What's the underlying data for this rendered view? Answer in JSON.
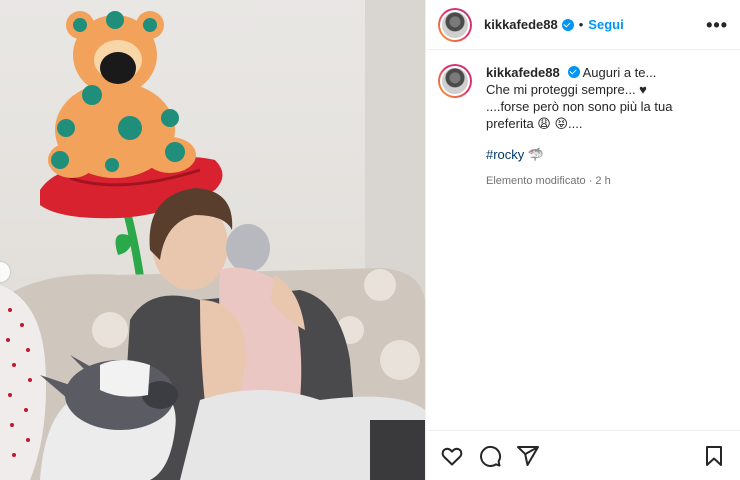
{
  "header": {
    "username": "kikkafede88",
    "follow_label": "Segui",
    "more_label": "•••"
  },
  "caption": {
    "username": "kikkafede88",
    "lines": [
      "Auguri a te...",
      "Che mi proteggi sempre... ♥",
      "....forse però non sono più la tua",
      "preferita 😩 😝...."
    ],
    "hashtag": "#rocky",
    "hashtag_emoji": "🦈",
    "meta": "Elemento modificato · 2 h"
  },
  "icons": {
    "like": "heart-icon",
    "comment": "comment-icon",
    "share": "share-icon",
    "save": "bookmark-icon"
  },
  "colors": {
    "accent": "#0095f6",
    "text": "#262626",
    "muted": "#737373",
    "hashtag": "#00376b"
  }
}
